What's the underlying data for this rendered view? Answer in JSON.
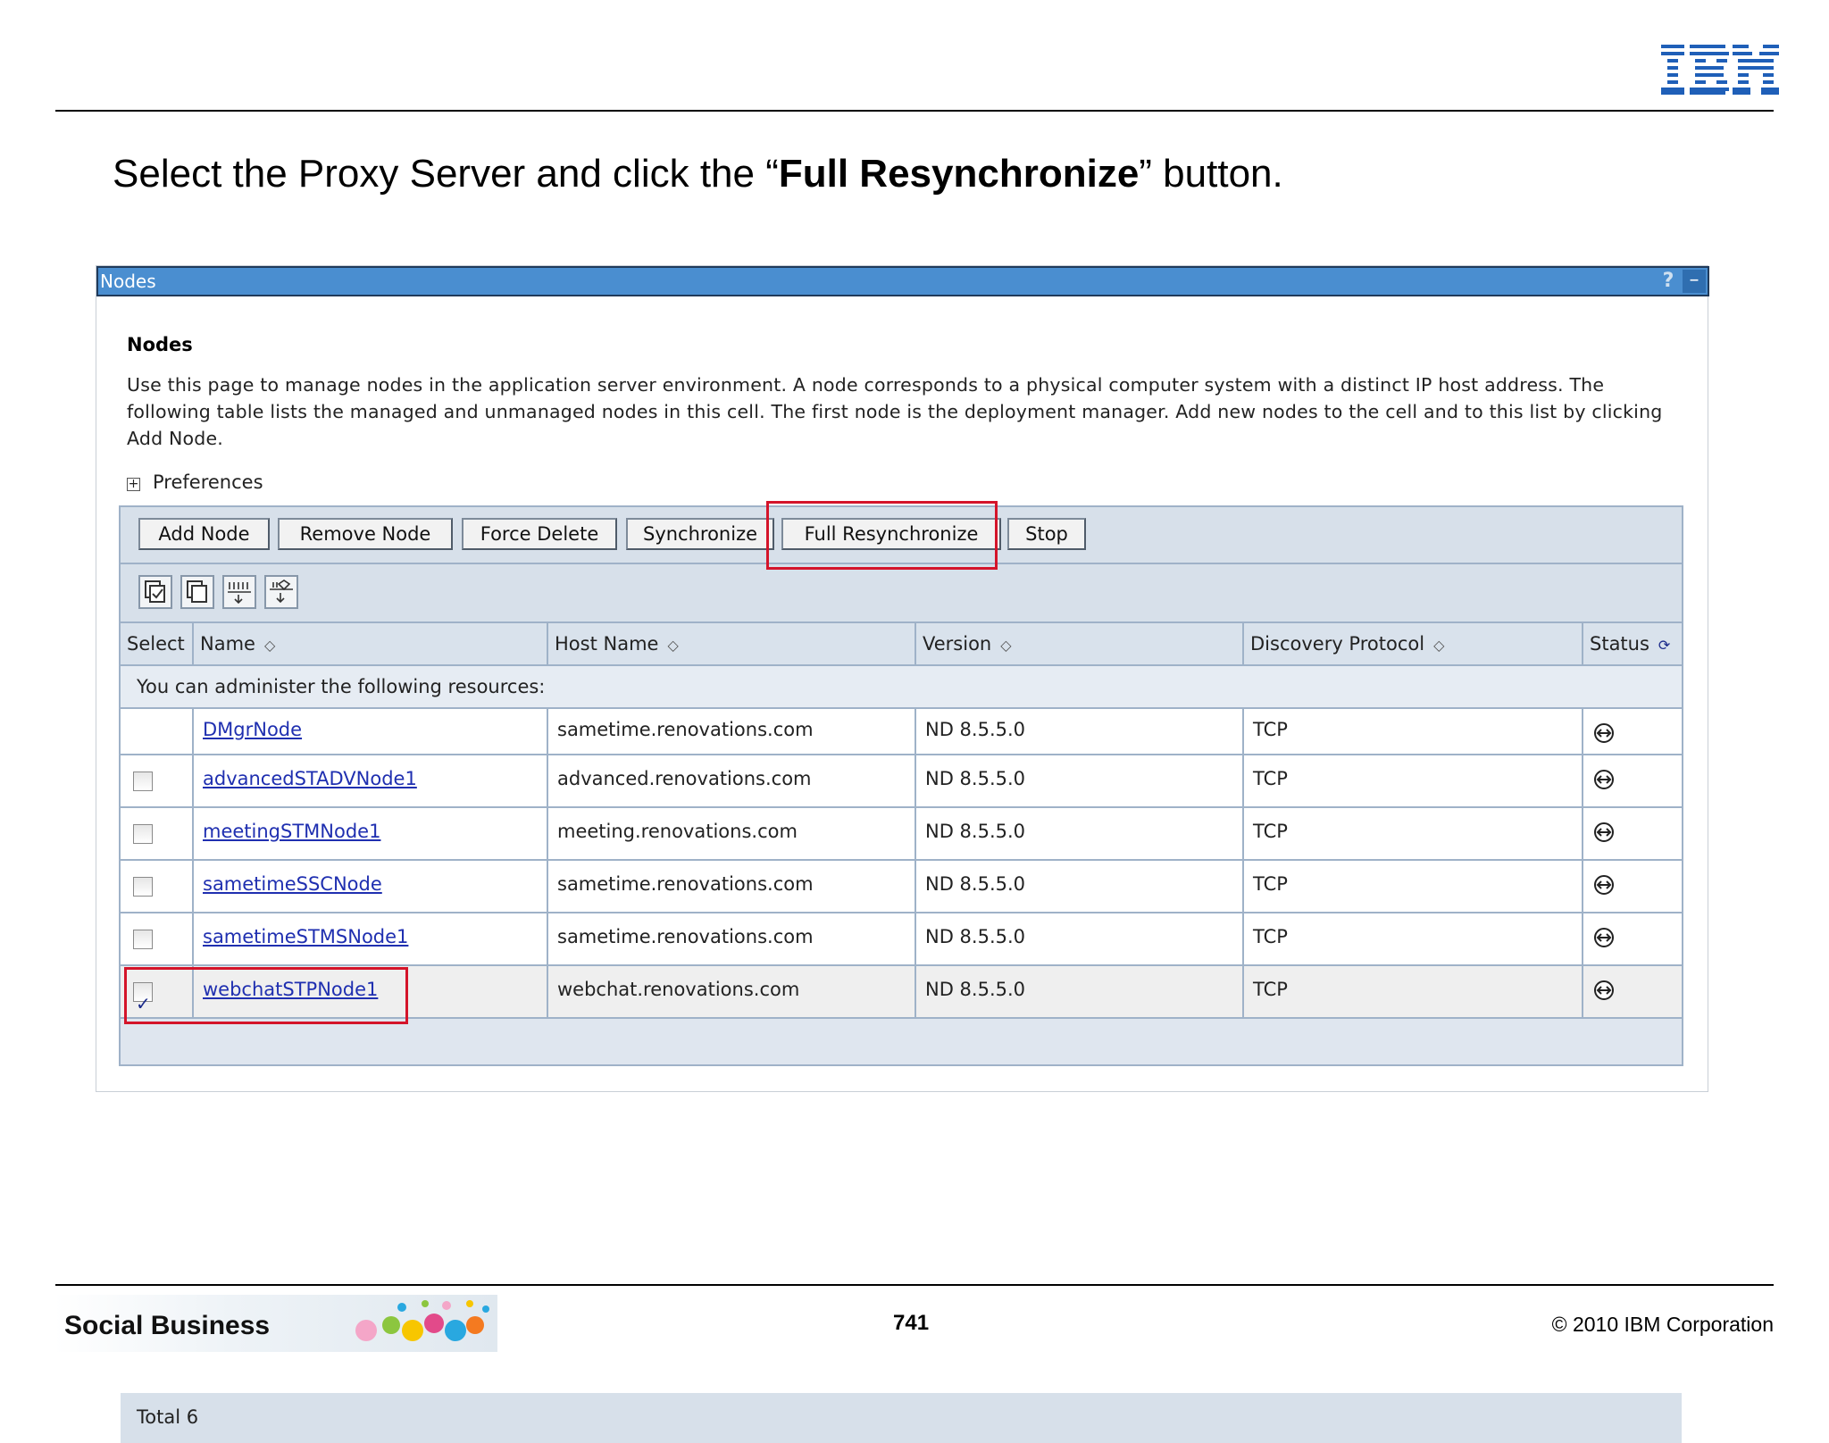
{
  "slide": {
    "title_prefix": "Select the Proxy Server and click the “",
    "title_bold": "Full Resynchronize",
    "title_suffix": "” button.",
    "page_number": "741",
    "copyright": "© 2010 IBM Corporation",
    "brand": "Social Business",
    "logo_text": "IBM"
  },
  "portlet": {
    "title": "Nodes",
    "help": "?",
    "minimize": "–",
    "heading": "Nodes",
    "description": "Use this page to manage nodes in the application server environment. A node corresponds to a physical computer system with a distinct IP host address. The following table lists the managed and unmanaged nodes in this cell. The first node is the deployment manager. Add new nodes to the cell and to this list by clicking Add Node.",
    "preferences": "Preferences",
    "plus_symbol": "+"
  },
  "buttons": {
    "add_node": "Add Node",
    "remove_node": "Remove Node",
    "force_delete": "Force Delete",
    "synchronize": "Synchronize",
    "full_resynchronize": "Full Resynchronize",
    "stop": "Stop"
  },
  "table": {
    "headers": {
      "select": "Select",
      "name": "Name",
      "host": "Host Name",
      "version": "Version",
      "protocol": "Discovery Protocol",
      "status": "Status"
    },
    "admin_message": "You can administer the following resources:",
    "rows": [
      {
        "name": "DMgrNode",
        "host": "sametime.renovations.com",
        "version": "ND 8.5.5.0",
        "protocol": "TCP",
        "checkbox": false,
        "checked": false
      },
      {
        "name": "advancedSTADVNode1",
        "host": "advanced.renovations.com",
        "version": "ND 8.5.5.0",
        "protocol": "TCP",
        "checkbox": true,
        "checked": false
      },
      {
        "name": "meetingSTMNode1",
        "host": "meeting.renovations.com",
        "version": "ND 8.5.5.0",
        "protocol": "TCP",
        "checkbox": true,
        "checked": false
      },
      {
        "name": "sametimeSSCNode",
        "host": "sametime.renovations.com",
        "version": "ND 8.5.5.0",
        "protocol": "TCP",
        "checkbox": true,
        "checked": false
      },
      {
        "name": "sametimeSTMSNode1",
        "host": "sametime.renovations.com",
        "version": "ND 8.5.5.0",
        "protocol": "TCP",
        "checkbox": true,
        "checked": false
      },
      {
        "name": "webchatSTPNode1",
        "host": "webchat.renovations.com",
        "version": "ND 8.5.5.0",
        "protocol": "TCP",
        "checkbox": true,
        "checked": true
      }
    ],
    "total": "Total 6"
  },
  "icons": {
    "sort": "sort-arrows-icon",
    "status": "refresh-status-icon",
    "node_status": "node-sync-status-icon",
    "toolbar": [
      "select-all-icon",
      "deselect-all-icon",
      "expand-filter-icon",
      "filter-icon"
    ]
  },
  "colors": {
    "titlebar": "#4a8ed0",
    "callout": "#d4142a",
    "link": "#1f2fb0",
    "table_border": "#9fb2c8"
  }
}
